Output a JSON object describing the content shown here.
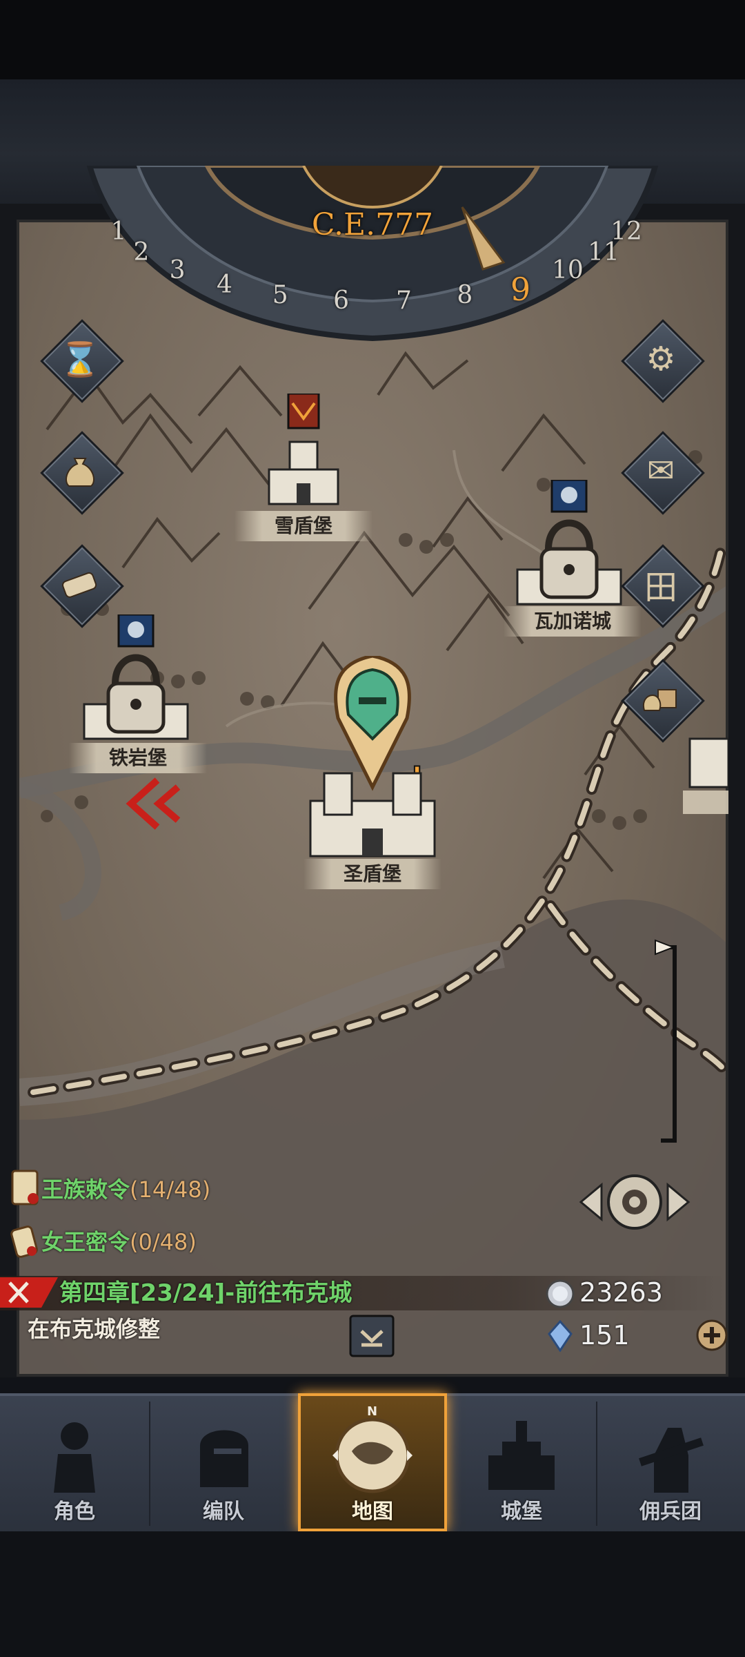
{
  "calendar": {
    "era": "C.E.777",
    "months": [
      "1",
      "2",
      "3",
      "4",
      "5",
      "6",
      "7",
      "8",
      "9",
      "10",
      "11",
      "12"
    ],
    "current_month": "9"
  },
  "side_buttons": {
    "left": [
      "hourglass-icon",
      "money-bag-icon",
      "scroll-icon"
    ],
    "right": [
      "gear-icon",
      "mail-icon",
      "window-grid-icon",
      "inventory-bag-icon"
    ]
  },
  "locations": {
    "xuedunbao": "雪盾堡",
    "wajianuocheng": "瓦加诺城",
    "tieyanbao": "铁岩堡",
    "shengdunbao": "圣盾堡"
  },
  "quests": [
    {
      "name": "王族敕令",
      "count": "(14/48)"
    },
    {
      "name": "女王密令",
      "count": "(0/48)"
    }
  ],
  "chapter": "第四章[23/24]-前往布克城",
  "subquest": "在布克城修整",
  "resources": {
    "silver": "23263",
    "crystal": "151"
  },
  "nav": [
    {
      "label": "角色",
      "icon": "knight-icon"
    },
    {
      "label": "编队",
      "icon": "helmet-icon"
    },
    {
      "label": "地图",
      "icon": "compass-map-icon",
      "active": true
    },
    {
      "label": "城堡",
      "icon": "castle-icon"
    },
    {
      "label": "佣兵团",
      "icon": "mercenary-icon"
    }
  ],
  "colors": {
    "accent": "#f0a23a",
    "quest_green": "#6fd36a",
    "map_paper": "#7d7163"
  }
}
